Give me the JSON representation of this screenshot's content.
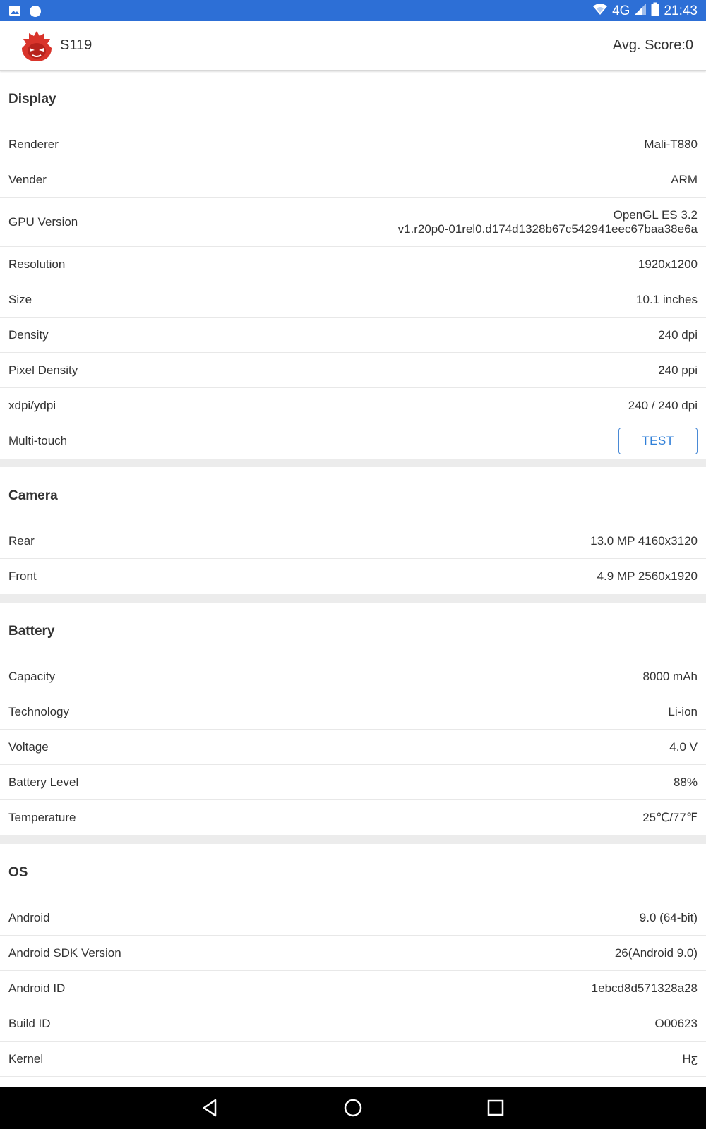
{
  "status_bar": {
    "network": "4G",
    "time": "21:43",
    "left_icons": [
      "image-icon",
      "app-notification-icon"
    ],
    "right_icons": [
      "wifi-icon",
      "signal-icon",
      "battery-icon"
    ]
  },
  "app_bar": {
    "title": "S119",
    "avg_score": "Avg. Score:0",
    "logo_icon": "antutu-logo-icon"
  },
  "sections": [
    {
      "title": "Display",
      "rows": [
        {
          "label": "Renderer",
          "value": "Mali-T880"
        },
        {
          "label": "Vender",
          "value": "ARM"
        },
        {
          "label": "GPU Version",
          "value_lines": [
            "OpenGL ES 3.2",
            "v1.r20p0-01rel0.d174d1328b67c542941eec67baa38e6a"
          ]
        },
        {
          "label": "Resolution",
          "value": "1920x1200"
        },
        {
          "label": "Size",
          "value": "10.1 inches"
        },
        {
          "label": "Density",
          "value": "240 dpi"
        },
        {
          "label": "Pixel Density",
          "value": "240 ppi"
        },
        {
          "label": "xdpi/ydpi",
          "value": "240 / 240 dpi"
        },
        {
          "label": "Multi-touch",
          "button": "TEST"
        }
      ]
    },
    {
      "title": "Camera",
      "rows": [
        {
          "label": "Rear",
          "value": "13.0 MP 4160x3120"
        },
        {
          "label": "Front",
          "value": "4.9 MP 2560x1920"
        }
      ]
    },
    {
      "title": "Battery",
      "rows": [
        {
          "label": "Capacity",
          "value": "8000 mAh"
        },
        {
          "label": "Technology",
          "value": "Li-ion"
        },
        {
          "label": "Voltage",
          "value": "4.0 V"
        },
        {
          "label": "Battery Level",
          "value": "88%"
        },
        {
          "label": "Temperature",
          "value": "25℃/77℉"
        }
      ]
    },
    {
      "title": "OS",
      "rows": [
        {
          "label": "Android",
          "value": "9.0 (64-bit)"
        },
        {
          "label": "Android SDK Version",
          "value": "26(Android 9.0)"
        },
        {
          "label": "Android ID",
          "value": "1ebcd8d571328a28"
        },
        {
          "label": "Build ID",
          "value": "O00623"
        },
        {
          "label": "Kernel",
          "value": "Hƹ"
        }
      ]
    }
  ],
  "nav_bar": {
    "buttons": [
      "back-icon",
      "home-icon",
      "recents-icon"
    ]
  },
  "colors": {
    "status_bar": "#2d6fd6",
    "accent": "#2f7fd8",
    "logo_red": "#d9342b",
    "section_gap": "#ececec"
  }
}
